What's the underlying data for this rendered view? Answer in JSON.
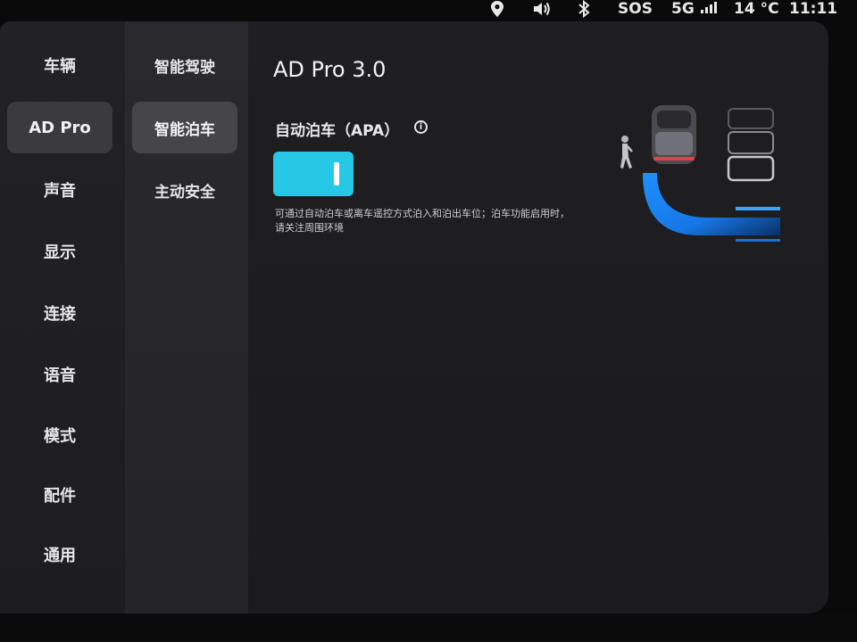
{
  "status_bar": {
    "sos": "SOS",
    "network": "5G",
    "temperature": "14 °C",
    "time": "11:11"
  },
  "sidebar": {
    "items": [
      {
        "label": "车辆"
      },
      {
        "label": "AD Pro",
        "active": true
      },
      {
        "label": "声音"
      },
      {
        "label": "显示"
      },
      {
        "label": "连接"
      },
      {
        "label": "语音"
      },
      {
        "label": "模式"
      },
      {
        "label": "配件"
      },
      {
        "label": "通用"
      }
    ]
  },
  "submenu": {
    "items": [
      {
        "label": "智能驾驶"
      },
      {
        "label": "智能泊车",
        "active": true
      },
      {
        "label": "主动安全"
      }
    ]
  },
  "main": {
    "title": "AD Pro 3.0",
    "apa": {
      "label": "自动泊车（APA）",
      "toggle_on": true,
      "description": "可通过自动泊车或离车遥控方式泊入和泊出车位；泊车功能启用时，请关注周围环境"
    }
  },
  "colors": {
    "accent": "#27c7e6",
    "active_item": "#3a3a3f"
  }
}
